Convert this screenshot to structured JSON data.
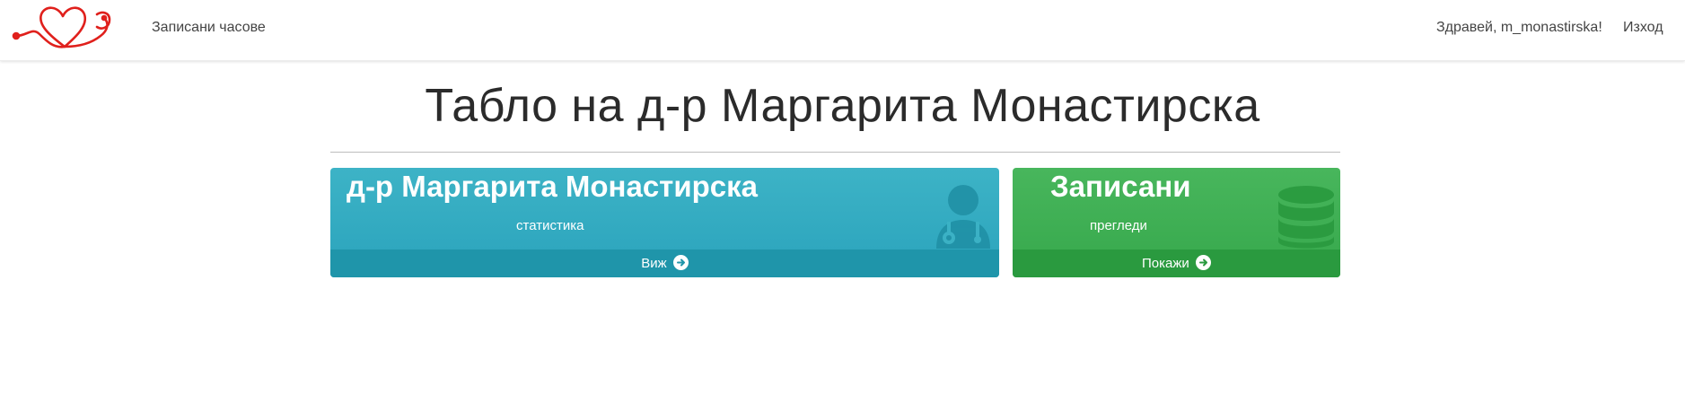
{
  "navbar": {
    "logo_icon": "heart-stethoscope-icon",
    "appointments_link": "Записани часове",
    "greeting": "Здравей, m_monastirska!",
    "logout_link": "Изход"
  },
  "page": {
    "title": "Табло на д-р Маргарита Монастирска"
  },
  "cards": {
    "doctor": {
      "title": "д-р Маргарита Монастирска",
      "subtitle": "статистика",
      "footer_label": "Виж",
      "icon": "user-doctor-icon",
      "color": "#2aa3bc"
    },
    "records": {
      "title": "Записани",
      "subtitle": "прегледи",
      "footer_label": "Покажи",
      "icon": "database-icon",
      "color": "#36a84c"
    }
  },
  "colors": {
    "logo_red": "#e0201c",
    "doctor_footer": "#1f95aa",
    "records_footer": "#2a9a3f"
  }
}
